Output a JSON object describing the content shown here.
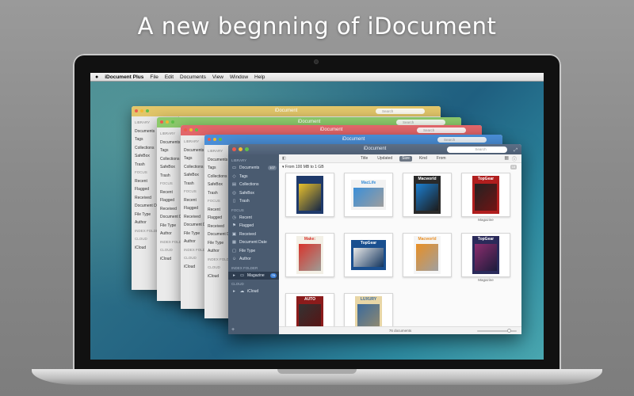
{
  "headline": "A new begnning of iDocument",
  "menubar": {
    "apple": "",
    "app_name": "iDocument Plus",
    "items": [
      "File",
      "Edit",
      "Documents",
      "View",
      "Window",
      "Help"
    ]
  },
  "background_windows": [
    {
      "title": "iDocument",
      "color": "#e2c66a",
      "search": "Search"
    },
    {
      "title": "iDocument",
      "color": "#8cc96b",
      "search": "Search"
    },
    {
      "title": "iDocument",
      "color": "#e2666a",
      "search": "Search"
    },
    {
      "title": "iDocument",
      "color": "#4a8fd8",
      "search": "Search"
    }
  ],
  "background_sidebar": {
    "library_header": "LIBRARY",
    "items": [
      "Documents",
      "Tags",
      "Collections",
      "SafeBox",
      "Trash"
    ],
    "focus_header": "FOCUS",
    "focus_items": [
      "Recent",
      "Flagged",
      "Received",
      "Document Date",
      "File Type",
      "Author"
    ],
    "index_header": "INDEX FOLDER",
    "cloud_header": "CLOUD",
    "cloud_items": [
      "iCloud"
    ]
  },
  "main_window": {
    "title": "iDocument",
    "search_placeholder": "Search",
    "sidebar": {
      "library_header": "LIBRARY",
      "documents_label": "Documents",
      "documents_count": "107",
      "tags_label": "Tags",
      "collections_label": "Collections",
      "safebox_label": "SafeBox",
      "trash_label": "Trash",
      "focus_header": "FOCUS",
      "recent_label": "Recent",
      "flagged_label": "Flagged",
      "received_label": "Received",
      "docdate_label": "Document Date",
      "filetype_label": "File Type",
      "author_label": "Author",
      "index_header": "INDEX FOLDER",
      "magazine_label": "Magazine",
      "magazine_count": "76",
      "cloud_header": "CLOUD",
      "icloud_label": "iCloud"
    },
    "toolbar": {
      "sorts": [
        "Title",
        "Updated",
        "Size",
        "Kind",
        "From"
      ],
      "active_sort": "Size"
    },
    "group_label": "From 100 MB to 1 GB",
    "group_count": "18",
    "covers": [
      {
        "title": "",
        "bg": "#1f3a6b",
        "accent": "#e9c12c",
        "caption": ""
      },
      {
        "title": "MacLife",
        "bg": "#f2f2f2",
        "accent": "#3b8fd8",
        "caption": ""
      },
      {
        "title": "Macworld",
        "bg": "#2a2a2a",
        "accent": "#1c7fd0",
        "caption": ""
      },
      {
        "title": "TopGear",
        "bg": "#b01e1e",
        "accent": "#222",
        "caption": "Magazine"
      },
      {
        "title": "Make:",
        "bg": "#f3f0e6",
        "accent": "#d8342c",
        "caption": ""
      },
      {
        "title": "TopGear",
        "bg": "#1a4f8f",
        "accent": "#e8e8e8",
        "caption": ""
      },
      {
        "title": "Macworld",
        "bg": "#f5f5f5",
        "accent": "#e88f25",
        "caption": ""
      },
      {
        "title": "TopGear",
        "bg": "#2a2a5a",
        "accent": "#8c2d6e",
        "caption": "Magazine"
      },
      {
        "title": "AUTO",
        "bg": "#8b1b1b",
        "accent": "#333",
        "caption": ""
      },
      {
        "title": "LUXURY",
        "bg": "#e8d6a6",
        "accent": "#3a6a9c",
        "caption": ""
      }
    ],
    "status_text": "76 documents"
  }
}
